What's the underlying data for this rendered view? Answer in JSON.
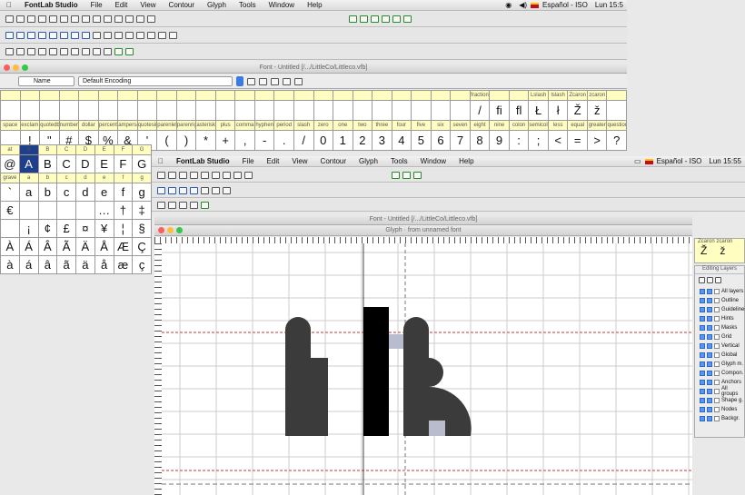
{
  "menubar": {
    "app": "FontLab Studio",
    "items": [
      "File",
      "Edit",
      "View",
      "Contour",
      "Glyph",
      "Tools",
      "Window",
      "Help"
    ],
    "lang": "Español - ISO",
    "clock_top": "Lun 15:5",
    "clock_front": "Lun 15:55"
  },
  "font_window": {
    "title": "Font - Untitled [/.../LittleCo/Littleco.vfb]",
    "name_select": "Name",
    "encoding_select": "Default Encoding"
  },
  "glyph_grid": {
    "row1_labels": [
      "",
      "",
      "",
      "",
      "",
      "",
      "",
      "",
      "",
      "",
      "",
      "",
      "",
      "",
      "",
      "",
      "",
      "",
      "",
      "",
      "",
      "",
      "",
      "",
      "fraction",
      "",
      "",
      "Lslash",
      "lslash",
      "Zcaron",
      "zcaron"
    ],
    "row2_glyphs": [
      "",
      "",
      "",
      "",
      "",
      "",
      "",
      "",
      "",
      "",
      "",
      "",
      "",
      "",
      "",
      "",
      "",
      "",
      "",
      "",
      "",
      "",
      "",
      "",
      "/",
      "ﬁ",
      "ﬂ",
      "Ł",
      "ł",
      "Ž",
      "ž"
    ],
    "row3_labels": [
      "space",
      "exclam",
      "quotedbl",
      "numbersign",
      "dollar",
      "percent",
      "ampersand",
      "quotesingle",
      "parenleft",
      "parenright",
      "asterisk",
      "plus",
      "comma",
      "hyphen",
      "period",
      "slash",
      "zero",
      "one",
      "two",
      "three",
      "four",
      "five",
      "six",
      "seven",
      "eight",
      "nine",
      "colon",
      "semicolon",
      "less",
      "equal",
      "greater",
      "question"
    ],
    "row4_glyphs": [
      "",
      "!",
      "\"",
      "#",
      "$",
      "%",
      "&",
      "'",
      "(",
      ")",
      "*",
      "+",
      ",",
      "-",
      ".",
      "/",
      "0",
      "1",
      "2",
      "3",
      "4",
      "5",
      "6",
      "7",
      "8",
      "9",
      ":",
      ";",
      "<",
      "=",
      ">",
      "?"
    ],
    "uc_labels": [
      "at",
      "A",
      "B",
      "C",
      "D",
      "E",
      "F",
      "G"
    ],
    "uc_glyphs": [
      "@",
      "A",
      "B",
      "C",
      "D",
      "E",
      "F",
      "G"
    ],
    "lc_labels": [
      "grave",
      "a",
      "b",
      "c",
      "d",
      "e",
      "f",
      "g"
    ],
    "lc_glyphs": [
      "`",
      "a",
      "b",
      "c",
      "d",
      "e",
      "f",
      "g"
    ],
    "misc1_glyphs": [
      "€",
      "",
      "",
      "",
      "",
      "…",
      "†",
      "‡"
    ],
    "misc2_glyphs": [
      "",
      "¡",
      "¢",
      "£",
      "¤",
      "¥",
      "¦",
      "§"
    ],
    "misc3_glyphs": [
      "À",
      "Á",
      "Â",
      "Ã",
      "Ä",
      "Å",
      "Æ",
      "Ç"
    ],
    "misc4_glyphs": [
      "à",
      "á",
      "â",
      "ã",
      "ä",
      "å",
      "æ",
      "ç"
    ]
  },
  "glyph_window": {
    "title": "Font - Untitled [/.../LittleCo/Littleco.vfb]",
    "glyph_label": "Glyph",
    "glyph_source": "from unnamed font",
    "text": "hlk"
  },
  "layers_panel": {
    "title": "Editing Layers",
    "items": [
      "All layers",
      "Outline",
      "Guidelines",
      "Hints",
      "Masks",
      "Grid",
      "Vertical",
      "Global",
      "Glyph m.",
      "Compon.",
      "Anchors",
      "All groups",
      "Shape g.",
      "Nodes",
      "Backgr."
    ]
  },
  "colors": {
    "selection": "#1f3f8a",
    "grid_header": "#fffdc0",
    "metric_line": "#c23a3a",
    "glyph_fill": "#3b3b3b",
    "glyph_black": "#000000"
  }
}
